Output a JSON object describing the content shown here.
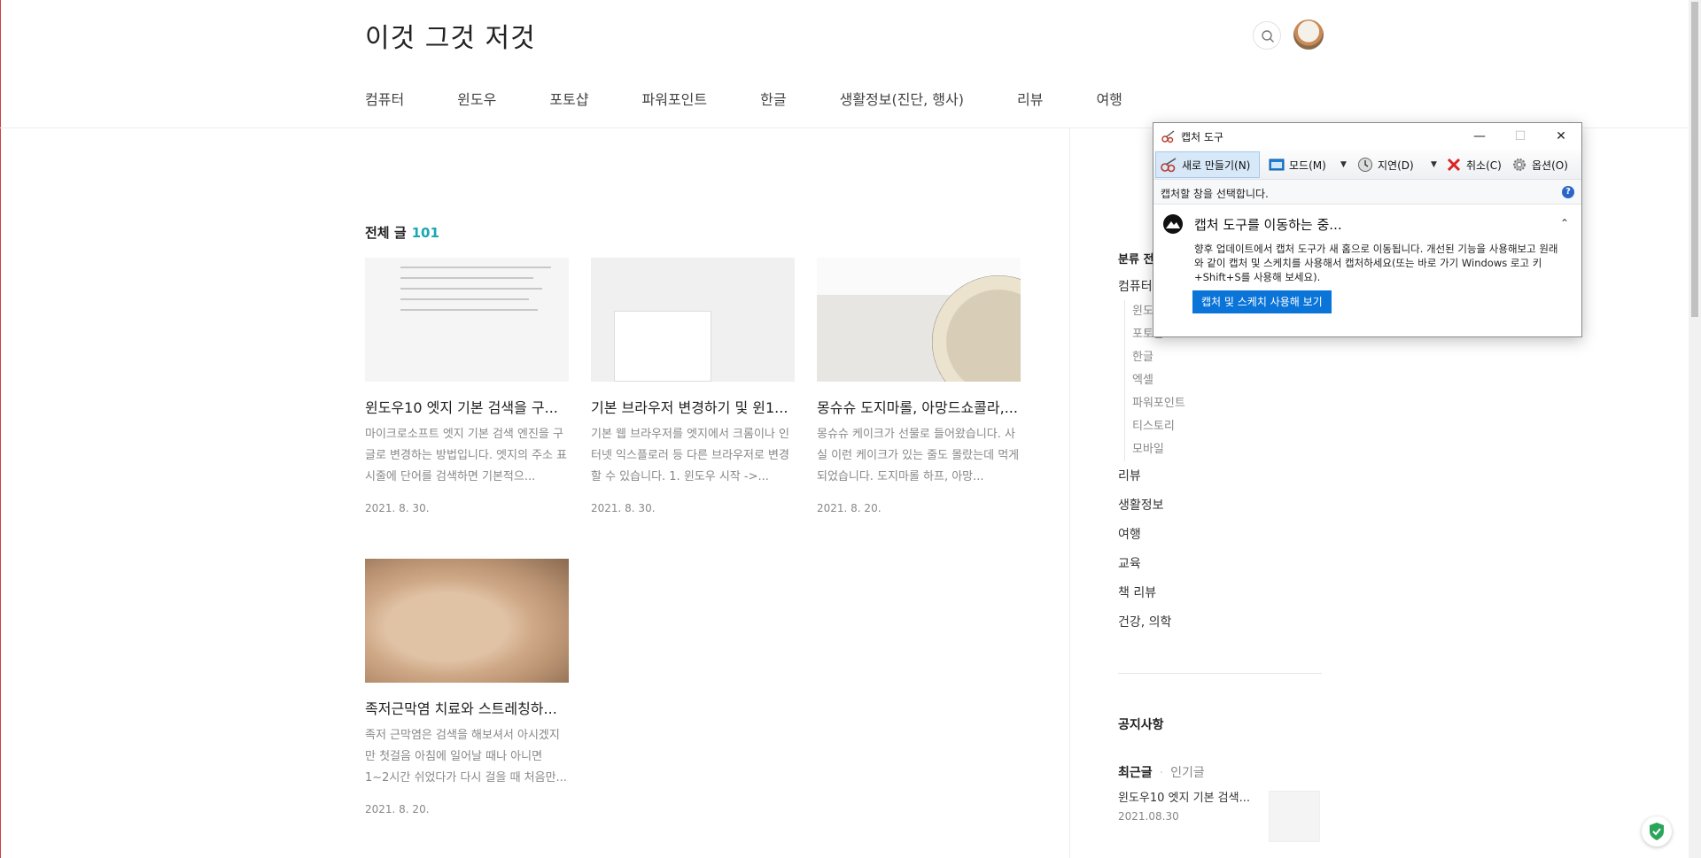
{
  "site": {
    "title": "이것 그것 저것"
  },
  "nav": [
    "컴퓨터",
    "윈도우",
    "포토샵",
    "파워포인트",
    "한글",
    "생활정보(진단, 행사)",
    "리뷰",
    "여행"
  ],
  "list": {
    "heading": "전체 글",
    "count": "101"
  },
  "posts": [
    {
      "title": "윈도우10 엣지 기본 검색을 구...",
      "desc": "마이크로소프트 엣지 기본 검색 엔진을 구글로 변경하는 방법입니다. 엣지의 주소 표시줄에 단어를 검색하면 기본적으...",
      "date": "2021. 8. 30."
    },
    {
      "title": "기본 브라우저 변경하기 및 윈1...",
      "desc": "기본 웹 브라우저를 엣지에서 크롬이나 인터넷 익스플로러 등 다른 브라우저로 변경할 수 있습니다. 1. 윈도우 시작 ->...",
      "date": "2021. 8. 30."
    },
    {
      "title": "몽슈슈 도지마롤, 아망드쇼콜라,...",
      "desc": "몽슈슈 케이크가 선물로 들어왔습니다. 사실 이런 케이크가 있는 줄도 몰랐는데 먹게 되었습니다. 도지마롤 하프, 아망...",
      "date": "2021. 8. 20."
    },
    {
      "title": "족저근막염 치료와 스트레칭하...",
      "desc": "족저 근막염은 검색을 해보셔서 아시겠지만 첫걸음 아침에 일어날 때나 아니면 1~2시간 쉬었다가 다시 걸을 때 처음만...",
      "date": "2021. 8. 20."
    }
  ],
  "sidebar": {
    "category_title": "분류 전",
    "categories": [
      {
        "label": "컴퓨터",
        "subs": [
          "윈도우",
          "포토샵",
          "한글",
          "엑셀",
          "파워포인트",
          "티스토리",
          "모바일"
        ]
      },
      {
        "label": "리뷰",
        "subs": []
      },
      {
        "label": "생활정보",
        "subs": []
      },
      {
        "label": "여행",
        "subs": []
      },
      {
        "label": "교육",
        "subs": []
      },
      {
        "label": "책 리뷰",
        "subs": []
      },
      {
        "label": "건강, 의학",
        "subs": []
      }
    ],
    "notice_title": "공지사항",
    "recent_tab": "최근글",
    "popular_tab": "인기글",
    "recent_item": {
      "title": "윈도우10 엣지 기본 검색...",
      "date": "2021.08.30"
    }
  },
  "snipping_tool": {
    "title": "캡처 도구",
    "new_label": "새로 만들기(N)",
    "mode_label": "모드(M)",
    "delay_label": "지연(D)",
    "cancel_label": "취소(C)",
    "options_label": "옵션(O)",
    "status": "캡처할 창을 선택합니다.",
    "notice_title": "캡처 도구를 이동하는 중...",
    "notice_body": "향후 업데이트에서 캡처 도구가 새 홈으로 이동됩니다. 개선된 기능을 사용해보고 원래와 같이 캡처 및 스케치를 사용해서 캡처하세요(또는 바로 가기 Windows 로고 키+Shift+S를 사용해 보세요).",
    "notice_button": "캡처 및 스케치 사용해 보기"
  },
  "colors": {
    "accent": "#18a7b3",
    "snip_button": "#0a74d8",
    "edge_red": "#d04040"
  }
}
